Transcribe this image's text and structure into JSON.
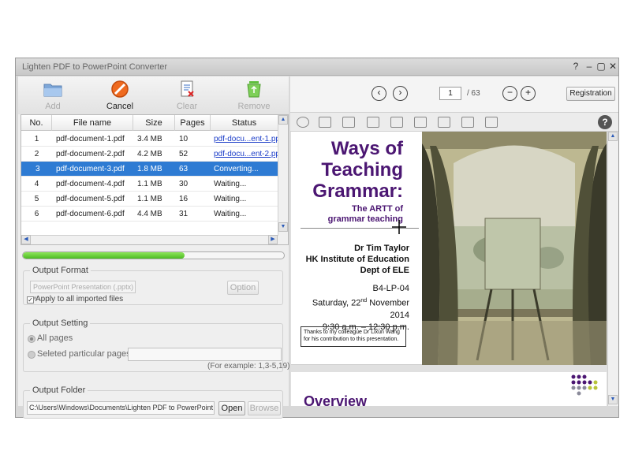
{
  "window": {
    "title": "Lighten PDF to PowerPoint Converter",
    "controls": [
      "?",
      "–",
      "▢",
      "✕"
    ]
  },
  "toolbar": {
    "add_label": "Add",
    "add_icon": "folder-icon",
    "cancel_label": "Cancel",
    "cancel_icon": "stop-icon",
    "clear_label": "Clear",
    "clear_icon": "clear-list-icon",
    "remove_label": "Remove",
    "remove_icon": "recycle-bin-icon"
  },
  "table": {
    "headers": [
      "No.",
      "File name",
      "Size",
      "Pages",
      "Status"
    ],
    "rows": [
      {
        "no": "1",
        "name": "pdf-document-1.pdf",
        "size": "3.4 MB",
        "pages": "10",
        "status": "pdf-docu...ent-1.pptx",
        "link": true,
        "selected": false
      },
      {
        "no": "2",
        "name": "pdf-document-2.pdf",
        "size": "4.2 MB",
        "pages": "52",
        "status": "pdf-docu...ent-2.pptx",
        "link": true,
        "selected": false
      },
      {
        "no": "3",
        "name": "pdf-document-3.pdf",
        "size": "1.8 MB",
        "pages": "63",
        "status": "Converting...",
        "link": false,
        "selected": true
      },
      {
        "no": "4",
        "name": "pdf-document-4.pdf",
        "size": "1.1 MB",
        "pages": "30",
        "status": "Waiting...",
        "link": false,
        "selected": false
      },
      {
        "no": "5",
        "name": "pdf-document-5.pdf",
        "size": "1.1 MB",
        "pages": "16",
        "status": "Waiting...",
        "link": false,
        "selected": false
      },
      {
        "no": "6",
        "name": "pdf-document-6.pdf",
        "size": "4.4 MB",
        "pages": "31",
        "status": "Waiting...",
        "link": false,
        "selected": false
      }
    ]
  },
  "progress": {
    "fraction": 0.62,
    "color": "#4cbb22"
  },
  "output_format": {
    "legend": "Output Format",
    "select_value": "PowerPoint Presentation (.pptx)",
    "option_label": "Option",
    "apply_all_label": "Apply to all imported files",
    "apply_all_checked": true
  },
  "output_setting": {
    "legend": "Output Setting",
    "all_pages_label": "All pages",
    "particular_label": "Seleted particular pages",
    "pages_input_value": "",
    "example": "(For example: 1,3-5,19)"
  },
  "output_folder": {
    "legend": "Output Folder",
    "path": "C:\\Users\\Windows\\Documents\\Lighten PDF to PowerPoint Conver",
    "open_label": "Open",
    "browse_label": "Browse"
  },
  "preview": {
    "prev_icon": "chevron-left-icon",
    "next_icon": "chevron-right-icon",
    "current_page": "1",
    "total_pages": "/ 63",
    "registration_label": "Registration",
    "help": "?"
  },
  "slide": {
    "title_lines": [
      "Ways of",
      "Teaching",
      "Grammar:"
    ],
    "subtitle_lines": [
      "The ARTT of",
      "grammar teaching"
    ],
    "author_lines": [
      "Dr Tim Taylor",
      "HK Institute of Education",
      "Dept of ELE"
    ],
    "room": "B4-LP-04",
    "date_pre": "Saturday, 22",
    "date_sup": "nd",
    "date_post": " November 2014",
    "time": "9:30 a.m. – 12:30 p.m.",
    "thanks_lines": [
      "Thanks to my colleague Dr Lixun Wang",
      "for his contribution to this presentation."
    ],
    "next_title": "Overview",
    "accent": "#4b1672"
  }
}
